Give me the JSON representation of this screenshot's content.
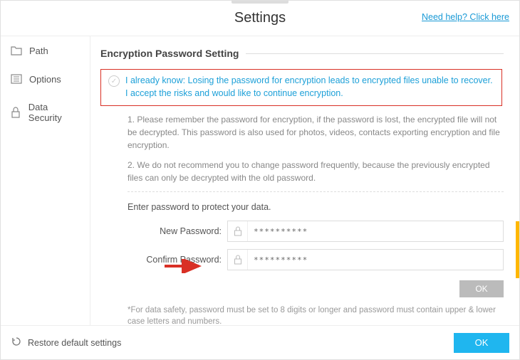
{
  "header": {
    "title": "Settings",
    "help_link": "Need help? Click here"
  },
  "sidebar": {
    "items": [
      {
        "label": "Path",
        "icon": "folder"
      },
      {
        "label": "Options",
        "icon": "list"
      },
      {
        "label": "Data Security",
        "icon": "lock"
      }
    ]
  },
  "section": {
    "title": "Encryption Password Setting",
    "warning": "I already know: Losing the password for encryption leads to encrypted files unable to recover. I accept the risks and would like to continue encryption.",
    "note1": "1. Please remember the password for encryption, if the password is lost, the encrypted file will not be decrypted. This password is also used for photos, videos, contacts exporting encryption and file encryption.",
    "note2": "2. We do not recommend you to change password frequently, because the previously encrypted files can only be decrypted with the old password.",
    "prompt": "Enter password to protect your data.",
    "new_pwd_label": "New Password:",
    "confirm_pwd_label": "Confirm Password:",
    "new_pwd_value": "**********",
    "confirm_pwd_value": "**********",
    "ok_small": "OK",
    "hint": "*For data safety, password must be set to 8 digits or longer and password must contain upper & lower case letters and numbers."
  },
  "footer": {
    "restore": "Restore default settings",
    "ok": "OK"
  }
}
